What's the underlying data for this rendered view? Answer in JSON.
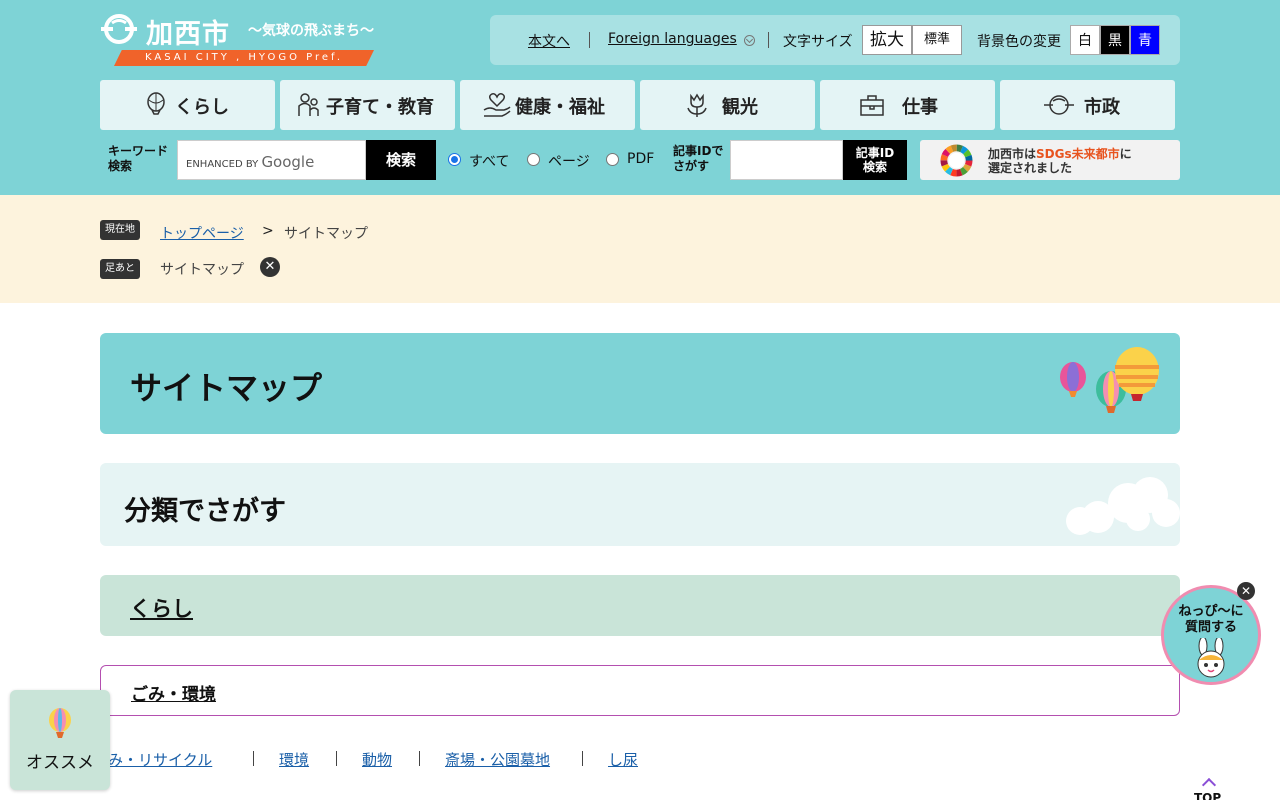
{
  "header": {
    "logo_name": "加西市",
    "logo_tagline": "〜気球の飛ぶまち〜",
    "logo_en": "KASAI CITY , HYOGO Pref.",
    "colors": {
      "header_bg": "#7ed3d6",
      "ribbon": "#f0632a"
    }
  },
  "utility": {
    "skip_to_content": "本文へ",
    "foreign_languages": "Foreign languages",
    "font_size_label": "文字サイズ",
    "font_large": "拡大",
    "font_standard": "標準",
    "bg_color_label": "背景色の変更",
    "bg_white": "白",
    "bg_black": "黒",
    "bg_blue": "青"
  },
  "global_nav": [
    {
      "label": "くらし",
      "icon": "balloon-icon"
    },
    {
      "label": "子育て・教育",
      "icon": "family-icon"
    },
    {
      "label": "健康・福祉",
      "icon": "heart-hand-icon"
    },
    {
      "label": "観光",
      "icon": "tulip-icon"
    },
    {
      "label": "仕事",
      "icon": "briefcase-icon"
    },
    {
      "label": "市政",
      "icon": "city-logo-icon"
    }
  ],
  "search": {
    "keyword_label_1": "キーワード",
    "keyword_label_2": "検索",
    "brand_small": "ENHANCED BY",
    "brand_google": "Google",
    "button": "検索",
    "options": [
      "すべて",
      "ページ",
      "PDF"
    ],
    "selected_option": "すべて",
    "id_label_1": "記事IDで",
    "id_label_2": "さがす",
    "id_button_1": "記事ID",
    "id_button_2": "検索"
  },
  "sdgs": {
    "line1_prefix": "加西市は",
    "line1_highlight": "SDGs未来都市",
    "line1_suffix": "に",
    "line2": "選定されました"
  },
  "breadcrumb": {
    "current_tag": "現在地",
    "home": "トップページ",
    "separator": ">",
    "current": "サイトマップ",
    "history_tag": "足あと",
    "history_item": "サイトマップ"
  },
  "main": {
    "page_title": "サイトマップ",
    "section_title": "分類でさがす",
    "category": "くらし",
    "subcategory": "ごみ・環境",
    "leaf_links": [
      "ごみ・リサイクル",
      "環境",
      "動物",
      "斎場・公園墓地",
      "し尿"
    ]
  },
  "floating": {
    "recommend_label": "オススメ",
    "chat_line1": "ねっぴ〜に",
    "chat_line2": "質問する",
    "to_top": "TOP"
  }
}
